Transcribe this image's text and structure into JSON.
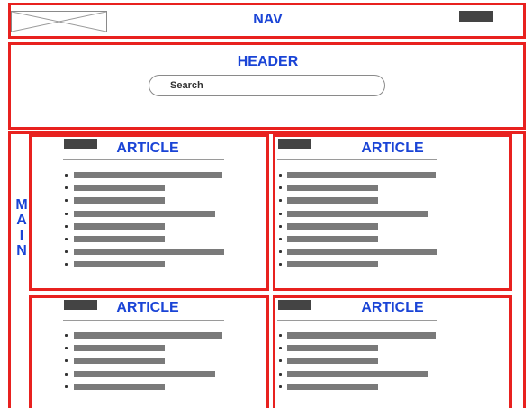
{
  "nav": {
    "title": "NAV"
  },
  "header": {
    "title": "HEADER",
    "search_placeholder": "Search"
  },
  "main": {
    "letters": [
      "M",
      "A",
      "I",
      "N"
    ]
  },
  "articles": [
    {
      "title": "ARTICLE",
      "list_lines": 8
    },
    {
      "title": "ARTICLE",
      "list_lines": 8
    },
    {
      "title": "ARTICLE",
      "list_lines": 5
    },
    {
      "title": "ARTICLE",
      "list_lines": 5
    }
  ],
  "colors": {
    "outline": "#e8211f",
    "label": "#1a44d6",
    "placeholder_bar": "#7a7a7a",
    "dark_block": "#444444"
  }
}
